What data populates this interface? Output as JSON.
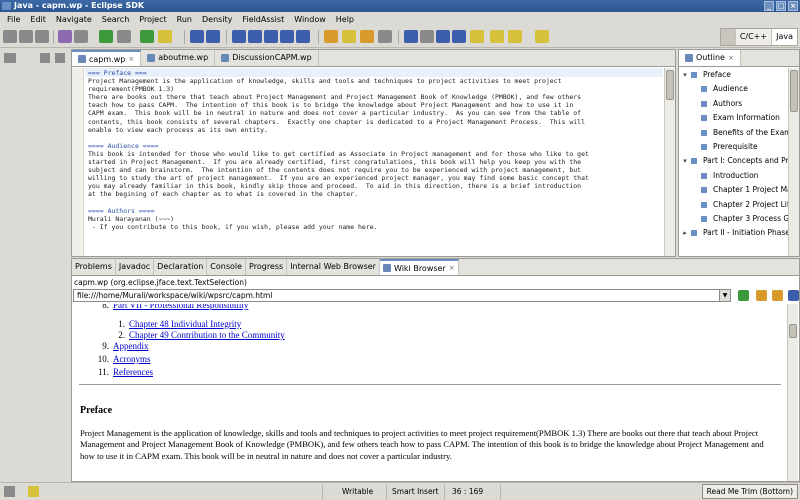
{
  "window": {
    "title": "Java - capm.wp - Eclipse SDK"
  },
  "menu": [
    "File",
    "Edit",
    "Navigate",
    "Search",
    "Project",
    "Run",
    "Density",
    "FieldAssist",
    "Window",
    "Help"
  ],
  "perspectives": {
    "cpp": "C/C++",
    "java": "Java"
  },
  "editor": {
    "tabs": [
      {
        "label": "capm.wp",
        "active": true
      },
      {
        "label": "aboutme.wp",
        "active": false
      },
      {
        "label": "DiscussionCAPM.wp",
        "active": false
      }
    ],
    "lines": [
      "=== Preface ===",
      "Project Management is the application of knowledge, skills and tools and techniques to project activities to meet project",
      "requirement(PMBOK 1.3)",
      "There are books out there that teach about Project Management and Project Management Book of Knowledge (PMBOK), and few others",
      "teach how to pass CAPM.  The intention of this book is to bridge the knowledge about Project Management and how to use it in",
      "CAPM exam.  This book will be in neutral in nature and does not cover a particular industry.  As you can see from the table of",
      "contents, this book consists of several chapters.  Exactly one chapter is dedicated to a Project Management Process.  This will",
      "enable to view each process as its own entity.",
      "",
      "==== Audience ====",
      "This book is intended for those who would like to get certified as Associate in Project management and for those who like to get",
      "started in Project Management.  If you are already certified, first congratulations, this book will help you keep you with the",
      "subject and can brainstorm.  The intention of the contents does not require you to be experienced with project management, but",
      "willing to study the art of project management.  If you are an experienced project manager, you may find some basic concept that",
      "you may already familiar in this book, kindly skip those and proceed.  To aid in this direction, there is a brief introduction",
      "at the begining of each chapter as to what is covered in the chapter.",
      "",
      "==== Authors ====",
      "Murali Narayanan (~~~)",
      " - If you contribute to this book, if you wish, please add your name here."
    ]
  },
  "outline": {
    "title": "Outline",
    "items": [
      {
        "label": "Preface",
        "level": 0,
        "expander": "open"
      },
      {
        "label": "Audience",
        "level": 1,
        "expander": ""
      },
      {
        "label": "Authors",
        "level": 1,
        "expander": ""
      },
      {
        "label": "Exam Information",
        "level": 1,
        "expander": ""
      },
      {
        "label": "Benefits of the Exam",
        "level": 1,
        "expander": ""
      },
      {
        "label": "Prerequisite",
        "level": 1,
        "expander": ""
      },
      {
        "label": "Part I: Concepts and Pra",
        "level": 0,
        "expander": "open"
      },
      {
        "label": "Introduction",
        "level": 1,
        "expander": ""
      },
      {
        "label": "Chapter 1 Project Ma",
        "level": 1,
        "expander": ""
      },
      {
        "label": "Chapter 2 Project Lif",
        "level": 1,
        "expander": ""
      },
      {
        "label": "Chapter 3 Process G",
        "level": 1,
        "expander": ""
      },
      {
        "label": "Part II - Initiation Phase",
        "level": 0,
        "expander": "closed"
      }
    ]
  },
  "bottom_panel": {
    "tabs": [
      "Problems",
      "Javadoc",
      "Declaration",
      "Console",
      "Progress",
      "Internal Web Browser",
      "Wiki Browser"
    ],
    "active_tab": "Wiki Browser",
    "selection_info": "capm.wp (org.eclipse.jface.text.TextSelection)",
    "url": "file:///home/Murali/workspace/wiki/wpsrc/capm.html"
  },
  "wiki": {
    "toc": [
      {
        "num": "8.",
        "text": "Part VII - Professional Responsibility",
        "indent": 0
      },
      {
        "num": "1.",
        "text": "Chapter 48 Individual Integrity",
        "indent": 1
      },
      {
        "num": "2.",
        "text": "Chapter 49 Contribution to the Community",
        "indent": 1
      },
      {
        "num": "9.",
        "text": "Appendix",
        "indent": 0
      },
      {
        "num": "10.",
        "text": "Acronyms",
        "indent": 0
      },
      {
        "num": "11.",
        "text": "References",
        "indent": 0
      }
    ],
    "heading": "Preface",
    "paragraph": "Project Management is the application of knowledge, skills and tools and techniques to project activities to meet project requirement(PMBOK 1.3) There are books out there that teach about Project Management and Project Management Book of Knowledge (PMBOK), and few others teach how to pass CAPM. The intention of this book is to bridge the knowledge about Project Management and how to use it in CAPM exam. This book will be in neutral in nature and does not cover a particular industry."
  },
  "status": {
    "writable": "Writable",
    "insert_mode": "Smart Insert",
    "position": "36 : 169",
    "trim": "Read Me Trim (Bottom)"
  }
}
